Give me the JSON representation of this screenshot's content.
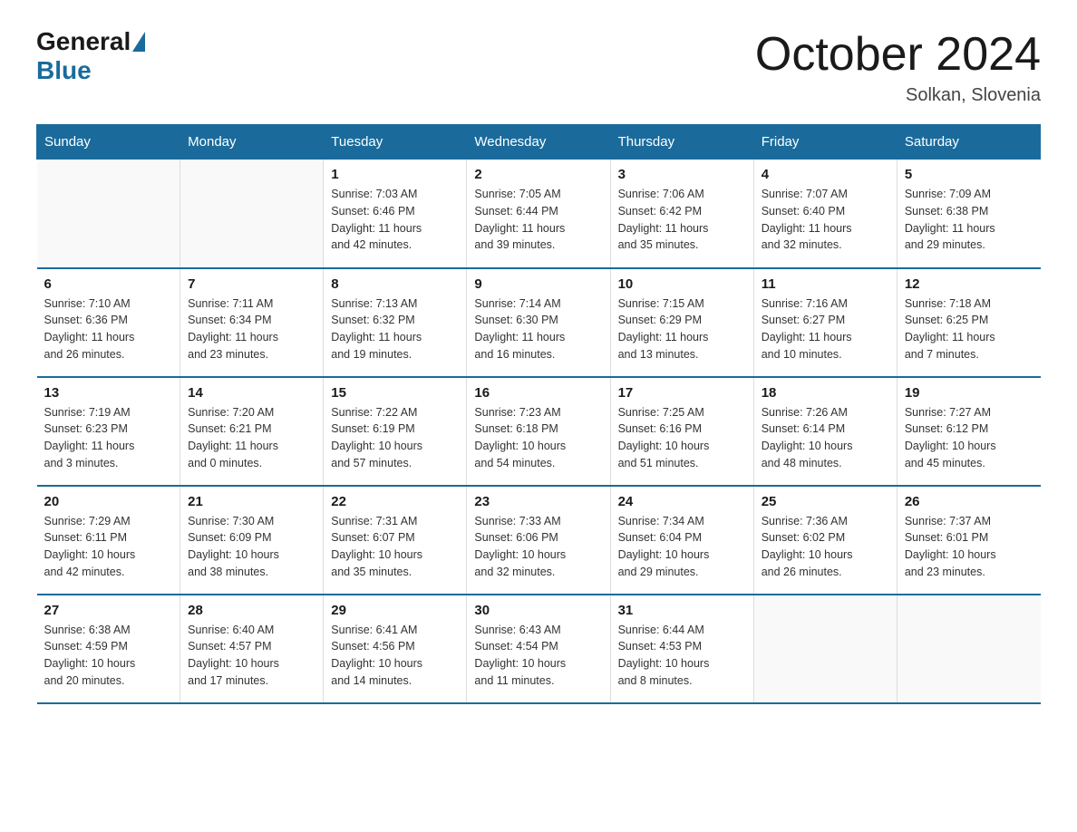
{
  "logo": {
    "general": "General",
    "blue": "Blue"
  },
  "title": "October 2024",
  "subtitle": "Solkan, Slovenia",
  "days_of_week": [
    "Sunday",
    "Monday",
    "Tuesday",
    "Wednesday",
    "Thursday",
    "Friday",
    "Saturday"
  ],
  "weeks": [
    [
      {
        "day": "",
        "info": ""
      },
      {
        "day": "",
        "info": ""
      },
      {
        "day": "1",
        "info": "Sunrise: 7:03 AM\nSunset: 6:46 PM\nDaylight: 11 hours\nand 42 minutes."
      },
      {
        "day": "2",
        "info": "Sunrise: 7:05 AM\nSunset: 6:44 PM\nDaylight: 11 hours\nand 39 minutes."
      },
      {
        "day": "3",
        "info": "Sunrise: 7:06 AM\nSunset: 6:42 PM\nDaylight: 11 hours\nand 35 minutes."
      },
      {
        "day": "4",
        "info": "Sunrise: 7:07 AM\nSunset: 6:40 PM\nDaylight: 11 hours\nand 32 minutes."
      },
      {
        "day": "5",
        "info": "Sunrise: 7:09 AM\nSunset: 6:38 PM\nDaylight: 11 hours\nand 29 minutes."
      }
    ],
    [
      {
        "day": "6",
        "info": "Sunrise: 7:10 AM\nSunset: 6:36 PM\nDaylight: 11 hours\nand 26 minutes."
      },
      {
        "day": "7",
        "info": "Sunrise: 7:11 AM\nSunset: 6:34 PM\nDaylight: 11 hours\nand 23 minutes."
      },
      {
        "day": "8",
        "info": "Sunrise: 7:13 AM\nSunset: 6:32 PM\nDaylight: 11 hours\nand 19 minutes."
      },
      {
        "day": "9",
        "info": "Sunrise: 7:14 AM\nSunset: 6:30 PM\nDaylight: 11 hours\nand 16 minutes."
      },
      {
        "day": "10",
        "info": "Sunrise: 7:15 AM\nSunset: 6:29 PM\nDaylight: 11 hours\nand 13 minutes."
      },
      {
        "day": "11",
        "info": "Sunrise: 7:16 AM\nSunset: 6:27 PM\nDaylight: 11 hours\nand 10 minutes."
      },
      {
        "day": "12",
        "info": "Sunrise: 7:18 AM\nSunset: 6:25 PM\nDaylight: 11 hours\nand 7 minutes."
      }
    ],
    [
      {
        "day": "13",
        "info": "Sunrise: 7:19 AM\nSunset: 6:23 PM\nDaylight: 11 hours\nand 3 minutes."
      },
      {
        "day": "14",
        "info": "Sunrise: 7:20 AM\nSunset: 6:21 PM\nDaylight: 11 hours\nand 0 minutes."
      },
      {
        "day": "15",
        "info": "Sunrise: 7:22 AM\nSunset: 6:19 PM\nDaylight: 10 hours\nand 57 minutes."
      },
      {
        "day": "16",
        "info": "Sunrise: 7:23 AM\nSunset: 6:18 PM\nDaylight: 10 hours\nand 54 minutes."
      },
      {
        "day": "17",
        "info": "Sunrise: 7:25 AM\nSunset: 6:16 PM\nDaylight: 10 hours\nand 51 minutes."
      },
      {
        "day": "18",
        "info": "Sunrise: 7:26 AM\nSunset: 6:14 PM\nDaylight: 10 hours\nand 48 minutes."
      },
      {
        "day": "19",
        "info": "Sunrise: 7:27 AM\nSunset: 6:12 PM\nDaylight: 10 hours\nand 45 minutes."
      }
    ],
    [
      {
        "day": "20",
        "info": "Sunrise: 7:29 AM\nSunset: 6:11 PM\nDaylight: 10 hours\nand 42 minutes."
      },
      {
        "day": "21",
        "info": "Sunrise: 7:30 AM\nSunset: 6:09 PM\nDaylight: 10 hours\nand 38 minutes."
      },
      {
        "day": "22",
        "info": "Sunrise: 7:31 AM\nSunset: 6:07 PM\nDaylight: 10 hours\nand 35 minutes."
      },
      {
        "day": "23",
        "info": "Sunrise: 7:33 AM\nSunset: 6:06 PM\nDaylight: 10 hours\nand 32 minutes."
      },
      {
        "day": "24",
        "info": "Sunrise: 7:34 AM\nSunset: 6:04 PM\nDaylight: 10 hours\nand 29 minutes."
      },
      {
        "day": "25",
        "info": "Sunrise: 7:36 AM\nSunset: 6:02 PM\nDaylight: 10 hours\nand 26 minutes."
      },
      {
        "day": "26",
        "info": "Sunrise: 7:37 AM\nSunset: 6:01 PM\nDaylight: 10 hours\nand 23 minutes."
      }
    ],
    [
      {
        "day": "27",
        "info": "Sunrise: 6:38 AM\nSunset: 4:59 PM\nDaylight: 10 hours\nand 20 minutes."
      },
      {
        "day": "28",
        "info": "Sunrise: 6:40 AM\nSunset: 4:57 PM\nDaylight: 10 hours\nand 17 minutes."
      },
      {
        "day": "29",
        "info": "Sunrise: 6:41 AM\nSunset: 4:56 PM\nDaylight: 10 hours\nand 14 minutes."
      },
      {
        "day": "30",
        "info": "Sunrise: 6:43 AM\nSunset: 4:54 PM\nDaylight: 10 hours\nand 11 minutes."
      },
      {
        "day": "31",
        "info": "Sunrise: 6:44 AM\nSunset: 4:53 PM\nDaylight: 10 hours\nand 8 minutes."
      },
      {
        "day": "",
        "info": ""
      },
      {
        "day": "",
        "info": ""
      }
    ]
  ]
}
